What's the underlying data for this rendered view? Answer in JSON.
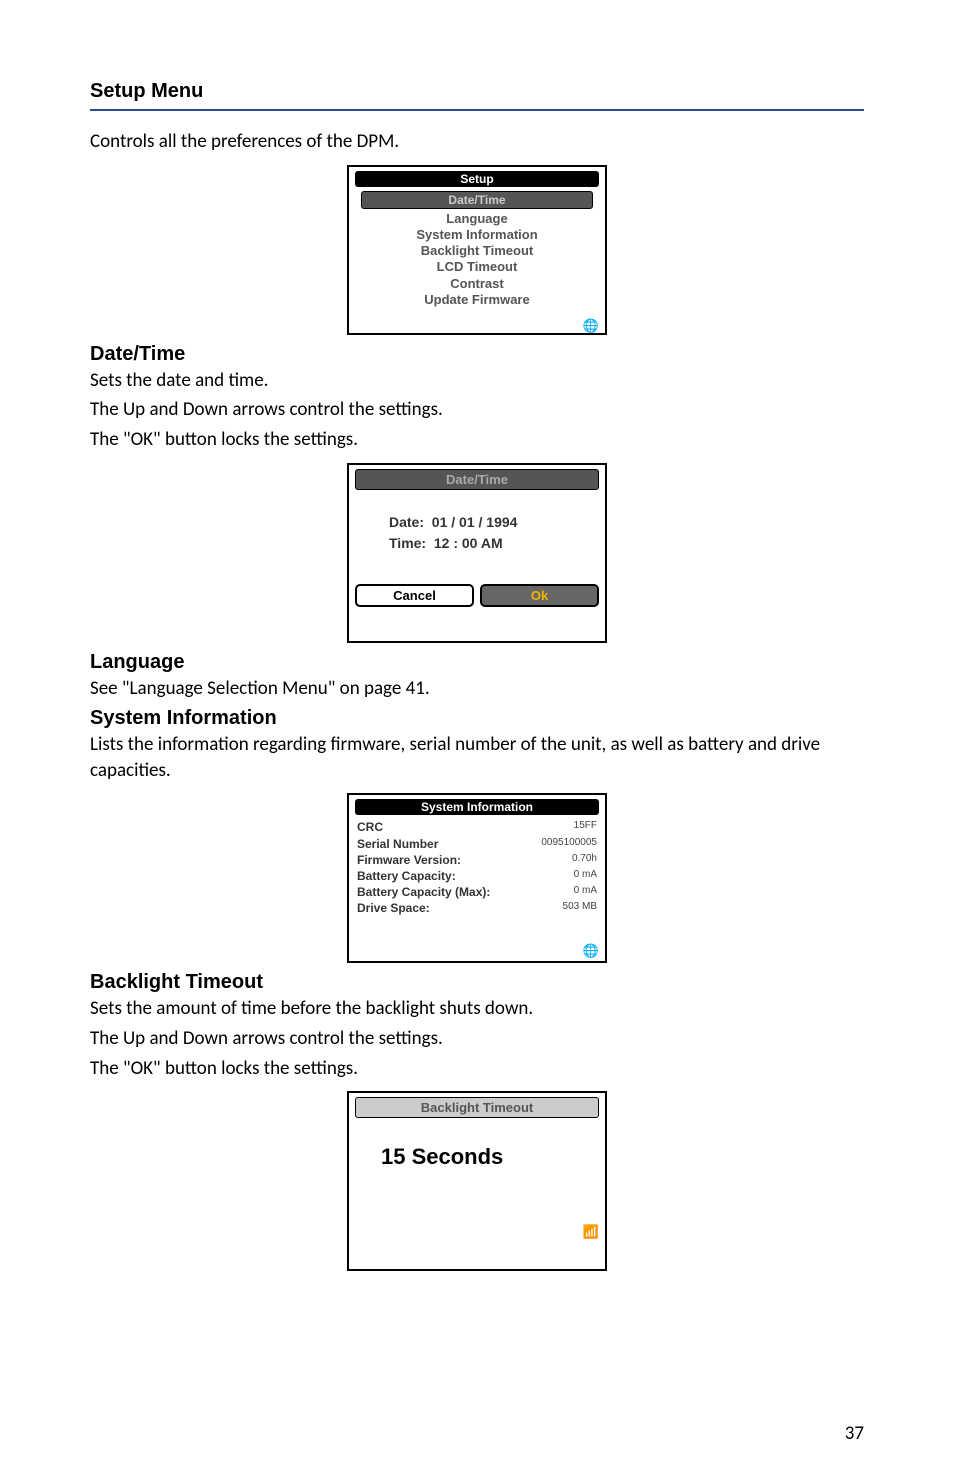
{
  "pageNumber": "37",
  "section": {
    "title": "Setup Menu",
    "intro": "Controls all the preferences of the DPM."
  },
  "setupScreen": {
    "titlebar": "Setup",
    "highlighted": "Date/Time",
    "items": [
      "Language",
      "System Information",
      "Backlight Timeout",
      "LCD Timeout",
      "Contrast",
      "Update Firmware"
    ]
  },
  "dateTime": {
    "heading": "Date/Time",
    "line1": "Sets the date and time.",
    "line2": "The Up and Down arrows control the settings.",
    "line3": "The \"OK\" button locks the settings.",
    "screenTitle": "Date/Time",
    "dateLabel": "Date:",
    "dateValue": "01 / 01 / 1994",
    "timeLabel": "Time:",
    "timeValue": "12 : 00  AM",
    "cancel": "Cancel",
    "ok": "Ok"
  },
  "language": {
    "heading": "Language",
    "text": "See \"Language Selection Menu\" on page 41."
  },
  "systemInfo": {
    "heading": "System Information",
    "text": "Lists the information regarding firmware, serial number of the unit, as well as battery and drive capacities.",
    "screenTitle": "System Information",
    "rows": [
      {
        "label": "CRC",
        "value": "15FF"
      },
      {
        "label": "Serial Number",
        "value": "0095100005"
      },
      {
        "label": "Firmware Version:",
        "value": "0.70h"
      },
      {
        "label": "Battery Capacity:",
        "value": "0 mA"
      },
      {
        "label": "Battery Capacity (Max):",
        "value": "0 mA"
      },
      {
        "label": "Drive Space:",
        "value": "503 MB"
      }
    ]
  },
  "backlight": {
    "heading": "Backlight Timeout",
    "line1": "Sets the amount of time before the backlight shuts down.",
    "line2": "The Up and Down arrows control the settings.",
    "line3": "The \"OK\" button locks the settings.",
    "screenTitle": "Backlight Timeout",
    "value": "15 Seconds"
  }
}
